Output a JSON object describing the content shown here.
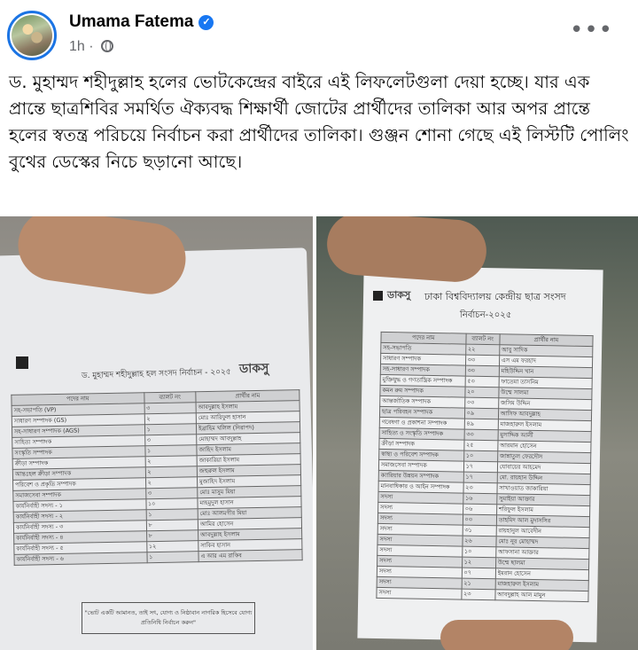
{
  "post": {
    "author": "Umama Fatema",
    "time": "1h",
    "caption": "ড. মুহাম্মদ শহীদুল্লাহ হলের ভোটকেন্দ্রের বাইরে এই লিফলেটগুলা দেয়া হচ্ছে। যার এক প্রান্তে ছাত্রশিবির সমর্থিত ঐক্যবদ্ধ শিক্ষার্থী জোটের প্রার্থীদের তালিকা আর অপর প্রান্তে হলের স্বতন্ত্র পরিচয়ে নির্বাচন করা প্রার্থীদের তালিকা। গুঞ্জন শোনা গেছে এই লিস্টটি পোলিং বুথের ডেস্কের নিচে ছড়ানো আছে।"
  },
  "icons": {
    "verified": "verified-badge-icon",
    "globe": "globe-icon",
    "more": "more-options-icon"
  },
  "colors": {
    "accent": "#1877f2",
    "secondary_text": "#65676b"
  },
  "photo_left": {
    "title": "ড. মুহাম্মদ শহীদুল্লাহ হল সংসদ নির্বাচন - ২০২৫",
    "brand": "ডাকসু",
    "headers": [
      "পদের নাম",
      "ব্যালট নং",
      "প্রার্থীর নাম"
    ],
    "rows": [
      [
        "সহ-সভাপতি (VP)",
        "৩",
        "আবদুল্লাহ ইসলাম"
      ],
      [
        "সাধারণ সম্পাদক (GS)",
        "২",
        "মোঃ আরিফুল হাসান"
      ],
      [
        "সহ-সাধারণ সম্পাদক (AGS)",
        "১",
        "ইব্রাহিম খলিল (নিরাপদ)"
      ],
      [
        "সাহিত্য সম্পাদক",
        "৩",
        "মোহাম্মদ আবদুল্লাহ"
      ],
      [
        "সংস্কৃতি সম্পাদক",
        "১",
        "জাহিদ ইসলাম"
      ],
      [
        "ক্রীড়া সম্পাদক",
        "২",
        "জাকারিয়া ইসলাম"
      ],
      [
        "আন্তঃহল ক্রীড়া সম্পাদক",
        "২",
        "জহুরুল ইসলাম"
      ],
      [
        "পরিবেশ ও প্রকৃতি সম্পাদক",
        "২",
        "মুজাহিদ ইসলাম"
      ],
      [
        "সমাজসেবা সম্পাদক",
        "৩",
        "মোঃ মাসুম মিয়া"
      ],
      [
        "কার্যনির্বাহী সদস্য - ১",
        "১০",
        "মাহমুদুল হাসান"
      ],
      [
        "কার্যনির্বাহী সদস্য - ২",
        "১",
        "মোঃ আলমগীর মিয়া"
      ],
      [
        "কার্যনির্বাহী সদস্য - ৩",
        "৮",
        "আমির হোসেন"
      ],
      [
        "কার্যনির্বাহী সদস্য - ৪",
        "৮",
        "আবদুল্লাহ ইসলাম"
      ],
      [
        "কার্যনির্বাহী সদস্য - ৫",
        "১২",
        "সাকিব হাসান"
      ],
      [
        "কার্যনির্বাহী সদস্য - ৬",
        "১",
        "এ আর এম রাকিব"
      ]
    ],
    "note": "\"ভোট একটি আমানত, তাই সৎ, যোগ্য ও নিষ্ঠাবান নাগরিক হিসেবে যোগ্য প্রতিনিধি নির্বাচন করুন\""
  },
  "photo_right": {
    "title": "ঢাকা বিশ্ববিদ্যালয় কেন্দ্রীয় ছাত্র সংসদ",
    "subtitle": "নির্বাচন-২০২৫",
    "brand": "ডাকসু",
    "headers": [
      "পদের নাম",
      "ব্যালট নং",
      "প্রার্থীর নাম"
    ],
    "rows": [
      [
        "সহ-সভাপতি",
        "২২",
        "আবু সাদিক"
      ],
      [
        "সাধারণ সম্পাদক",
        "৩৩",
        "এস এম ফরহাদ"
      ],
      [
        "সহ-সাধারণ সম্পাদক",
        "৩৩",
        "মহিউদ্দিন খান"
      ],
      [
        "মুক্তিযুদ্ধ ও গণতান্ত্রিক সম্পাদক",
        "৫৩",
        "ফাতেমা তাসনিম"
      ],
      [
        "কমন রুম সম্পাদক",
        "২০",
        "উম্মে সালমা"
      ],
      [
        "আন্তর্জাতিক সম্পাদক",
        "০৩",
        "জসিম উদ্দিন"
      ],
      [
        "ছাত্র পরিবহন সম্পাদক",
        "০৯",
        "আসিফ আবদুল্লাহ"
      ],
      [
        "গবেষণা ও প্রকাশনা সম্পাদক",
        "৪৯",
        "মাজহারুল ইসলাম"
      ],
      [
        "সাহিত্য ও সংস্কৃতি সম্পাদক",
        "৩৩",
        "মুসাদ্দিক আলী"
      ],
      [
        "ক্রীড়া সম্পাদক",
        "২৫",
        "আরমান হোসেন"
      ],
      [
        "স্বাস্থ্য ও পরিবেশ সম্পাদক",
        "১০",
        "জান্নাতুল ফেরদৌস"
      ],
      [
        "সমাজসেবা সম্পাদক",
        "১৭",
        "যোবায়ের আহমেদ"
      ],
      [
        "ক্যারিয়ার উন্নয়ন সম্পাদক",
        "১৭",
        "মো. রায়হান উদ্দিন"
      ],
      [
        "মানবাধিকার ও আইন সম্পাদক",
        "২৩",
        "সাখাওয়াত জাকারিয়া"
      ],
      [
        "সদস্য",
        "১৬",
        "সুমাইয়া আক্তার"
      ],
      [
        "সদস্য",
        "০৬",
        "শরিফুল ইসলাম"
      ],
      [
        "সদস্য",
        "০৩",
        "তাহমিদ আল মুদাসসির"
      ],
      [
        "সদস্য",
        "৩১",
        "রায়হানুল আবেদীন"
      ],
      [
        "সদস্য",
        "২৬",
        "মোঃ নূর মোহাম্মদ"
      ],
      [
        "সদস্য",
        "১০",
        "আফসানা আক্তার"
      ],
      [
        "সদস্য",
        "১২",
        "উম্মে ছালমা"
      ],
      [
        "সদস্য",
        "০৭",
        "ইমরান হোসেন"
      ],
      [
        "সদস্য",
        "২১",
        "মাজহারুল ইসলাম"
      ],
      [
        "সদস্য",
        "২৩",
        "আবদুল্লাহ আল মামুন"
      ]
    ]
  }
}
